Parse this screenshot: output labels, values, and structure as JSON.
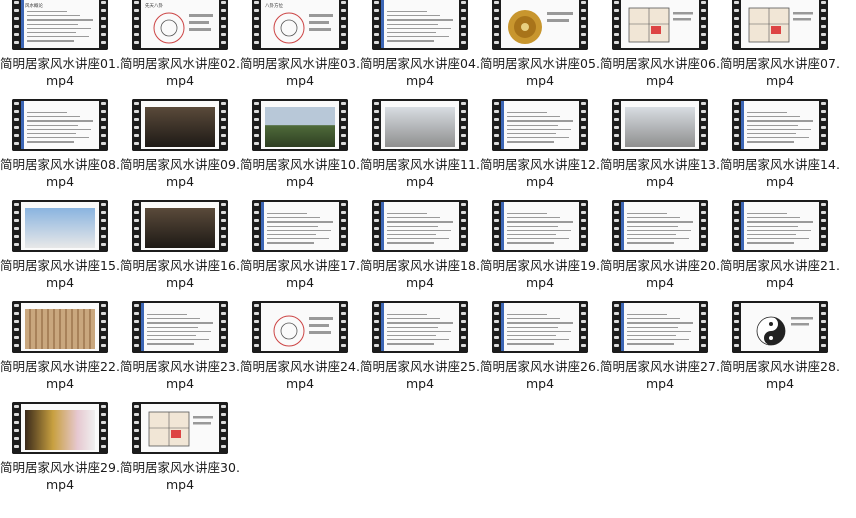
{
  "files": [
    {
      "name": "简明居家风水讲座01.mp4",
      "thumb": "text",
      "title": "风水概论"
    },
    {
      "name": "简明居家风水讲座02.mp4",
      "thumb": "diagram",
      "title": "先天八卦"
    },
    {
      "name": "简明居家风水讲座03.mp4",
      "thumb": "diagram",
      "title": "八卦方位"
    },
    {
      "name": "简明居家风水讲座04.mp4",
      "thumb": "text",
      "title": ""
    },
    {
      "name": "简明居家风水讲座05.mp4",
      "thumb": "compass",
      "title": ""
    },
    {
      "name": "简明居家风水讲座06.mp4",
      "thumb": "floorplan",
      "title": ""
    },
    {
      "name": "简明居家风水讲座07.mp4",
      "thumb": "floorplan",
      "title": ""
    },
    {
      "name": "简明居家风水讲座08.mp4",
      "thumb": "text",
      "title": ""
    },
    {
      "name": "简明居家风水讲座09.mp4",
      "thumb": "photo-dark",
      "title": ""
    },
    {
      "name": "简明居家风水讲座10.mp4",
      "thumb": "photo-hill",
      "title": ""
    },
    {
      "name": "简明居家风水讲座11.mp4",
      "thumb": "photo-building",
      "title": ""
    },
    {
      "name": "简明居家风水讲座12.mp4",
      "thumb": "text",
      "title": ""
    },
    {
      "name": "简明居家风水讲座13.mp4",
      "thumb": "photo-building",
      "title": ""
    },
    {
      "name": "简明居家风水讲座14.mp4",
      "thumb": "text",
      "title": ""
    },
    {
      "name": "简明居家风水讲座15.mp4",
      "thumb": "photo-house",
      "title": ""
    },
    {
      "name": "简明居家风水讲座16.mp4",
      "thumb": "photo-dark",
      "title": ""
    },
    {
      "name": "简明居家风水讲座17.mp4",
      "thumb": "text",
      "title": ""
    },
    {
      "name": "简明居家风水讲座18.mp4",
      "thumb": "text",
      "title": ""
    },
    {
      "name": "简明居家风水讲座19.mp4",
      "thumb": "text",
      "title": ""
    },
    {
      "name": "简明居家风水讲座20.mp4",
      "thumb": "text",
      "title": ""
    },
    {
      "name": "简明居家风水讲座21.mp4",
      "thumb": "text",
      "title": ""
    },
    {
      "name": "简明居家风水讲座22.mp4",
      "thumb": "photo-wood",
      "title": ""
    },
    {
      "name": "简明居家风水讲座23.mp4",
      "thumb": "text",
      "title": ""
    },
    {
      "name": "简明居家风水讲座24.mp4",
      "thumb": "diagram",
      "title": ""
    },
    {
      "name": "简明居家风水讲座25.mp4",
      "thumb": "text",
      "title": ""
    },
    {
      "name": "简明居家风水讲座26.mp4",
      "thumb": "text",
      "title": ""
    },
    {
      "name": "简明居家风水讲座27.mp4",
      "thumb": "text",
      "title": ""
    },
    {
      "name": "简明居家风水讲座28.mp4",
      "thumb": "yinyang",
      "title": ""
    },
    {
      "name": "简明居家风水讲座29.mp4",
      "thumb": "photo-objects",
      "title": ""
    },
    {
      "name": "简明居家风水讲座30.mp4",
      "thumb": "floorplan",
      "title": ""
    }
  ]
}
